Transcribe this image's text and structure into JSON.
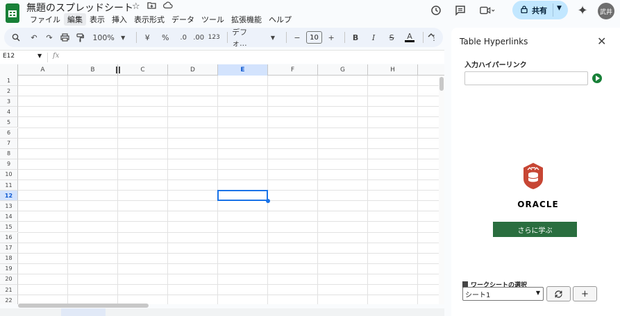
{
  "doc": {
    "title": "無題のスプレッドシート"
  },
  "menu": [
    "ファイル",
    "編集",
    "表示",
    "挿入",
    "表示形式",
    "データ",
    "ツール",
    "拡張機能",
    "ヘルプ"
  ],
  "menu_active_index": 1,
  "header": {
    "share_label": "共有",
    "avatar_text": "武井"
  },
  "toolbar": {
    "zoom": "100%",
    "currency": "¥",
    "percent": "%",
    "decimal_decrease": ".0",
    "decimal_increase": ".00",
    "number_format": "123",
    "font": "デフォ...",
    "font_size": "10",
    "bold": "B",
    "italic": "I",
    "strike": "S",
    "text_color": "A"
  },
  "formula_bar": {
    "cell_ref": "E12",
    "fx": "fx"
  },
  "grid": {
    "columns": [
      "A",
      "B",
      "C",
      "D",
      "E",
      "F",
      "G",
      "H"
    ],
    "rows": [
      "1",
      "2",
      "3",
      "4",
      "5",
      "6",
      "7",
      "8",
      "9",
      "10",
      "11",
      "12",
      "13",
      "14",
      "15",
      "16",
      "17",
      "18",
      "19",
      "20",
      "21",
      "22"
    ],
    "selected_col": "E",
    "selected_row": "12"
  },
  "panel": {
    "title": "Table Hyperlinks",
    "input_label": "入力ハイパーリンク",
    "brand": "ORACLE",
    "learn_more": "さらに学ぶ",
    "worksheet_label": "ワークシートの選択",
    "worksheet_value": "シート1",
    "add_label": "+"
  },
  "colors": {
    "accent": "#1a73e8",
    "sheets_green": "#188038",
    "oracle_red": "#c74634",
    "share_bg": "#c2e7ff"
  }
}
